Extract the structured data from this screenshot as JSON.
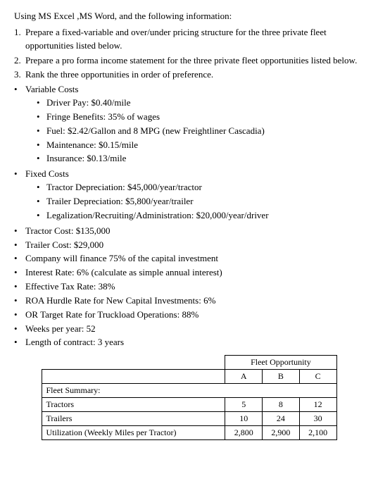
{
  "intro": {
    "line1": "Using MS Excel ,MS Word, and the following information:",
    "items": [
      {
        "num": "1.",
        "text": "Prepare a fixed-variable and over/under pricing structure for the three private fleet opportunities listed below."
      },
      {
        "num": "2.",
        "text": "Prepare a pro forma income statement for the three private fleet opportunities listed below."
      },
      {
        "num": "3.",
        "text": "Rank the three opportunities in order of preference."
      }
    ]
  },
  "bullet_sections": [
    {
      "label": "Variable Costs",
      "sub_items": [
        "Driver Pay:  $0.40/mile",
        "Fringe Benefits:  35% of wages",
        "Fuel:  $2.42/Gallon and 8 MPG (new Freightliner Cascadia)",
        "Maintenance:  $0.15/mile",
        "Insurance:  $0.13/mile"
      ]
    },
    {
      "label": "Fixed Costs",
      "sub_items": [
        "Tractor Depreciation:  $45,000/year/tractor",
        "Trailer Depreciation:  $5,800/year/trailer",
        "Legalization/Recruiting/Administration:  $20,000/year/driver"
      ]
    }
  ],
  "standalone_bullets": [
    "Tractor Cost:  $135,000",
    "Trailer Cost:  $29,000",
    "Company will finance 75% of the capital investment",
    "Interest Rate:  6% (calculate as simple annual interest)",
    "Effective Tax Rate:  38%",
    "ROA Hurdle Rate for New Capital Investments:  6%",
    "OR Target Rate for Truckload Operations:  88%",
    "Weeks per year:  52",
    "Length of contract:  3 years"
  ],
  "table": {
    "fleet_opportunity_header": "Fleet Opportunity",
    "col_headers": [
      "",
      "A",
      "B",
      "C"
    ],
    "section_header": "Fleet Summary:",
    "rows": [
      {
        "label": "Tractors",
        "a": "5",
        "b": "8",
        "c": "12"
      },
      {
        "label": "Trailers",
        "a": "10",
        "b": "24",
        "c": "30"
      },
      {
        "label": "Utilization (Weekly Miles per Tractor)",
        "a": "2,800",
        "b": "2,900",
        "c": "2,100"
      }
    ]
  },
  "icons": {
    "bullet": "•"
  }
}
